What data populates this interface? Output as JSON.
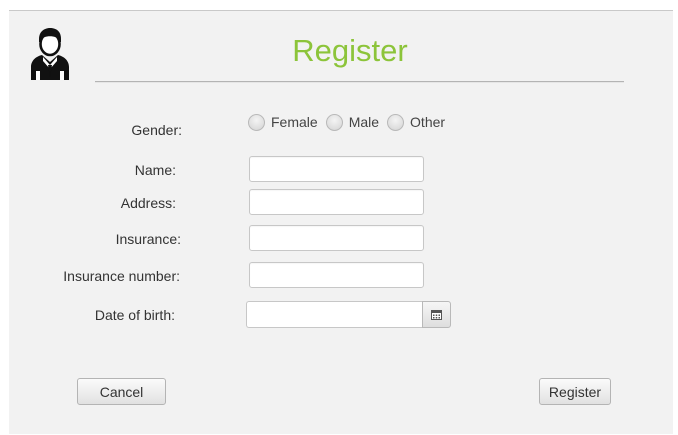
{
  "header": {
    "title": "Register",
    "icon": "user-avatar-icon",
    "accent_color": "#8cc43a"
  },
  "form": {
    "gender": {
      "label": "Gender:",
      "options": [
        "Female",
        "Male",
        "Other"
      ]
    },
    "name": {
      "label": "Name:",
      "value": ""
    },
    "address": {
      "label": "Address:",
      "value": ""
    },
    "insurance": {
      "label": "Insurance:",
      "value": ""
    },
    "insurance_number": {
      "label": "Insurance number:",
      "value": ""
    },
    "date_of_birth": {
      "label": "Date of birth:",
      "value": "",
      "icon": "calendar-icon"
    }
  },
  "actions": {
    "cancel_label": "Cancel",
    "register_label": "Register"
  }
}
